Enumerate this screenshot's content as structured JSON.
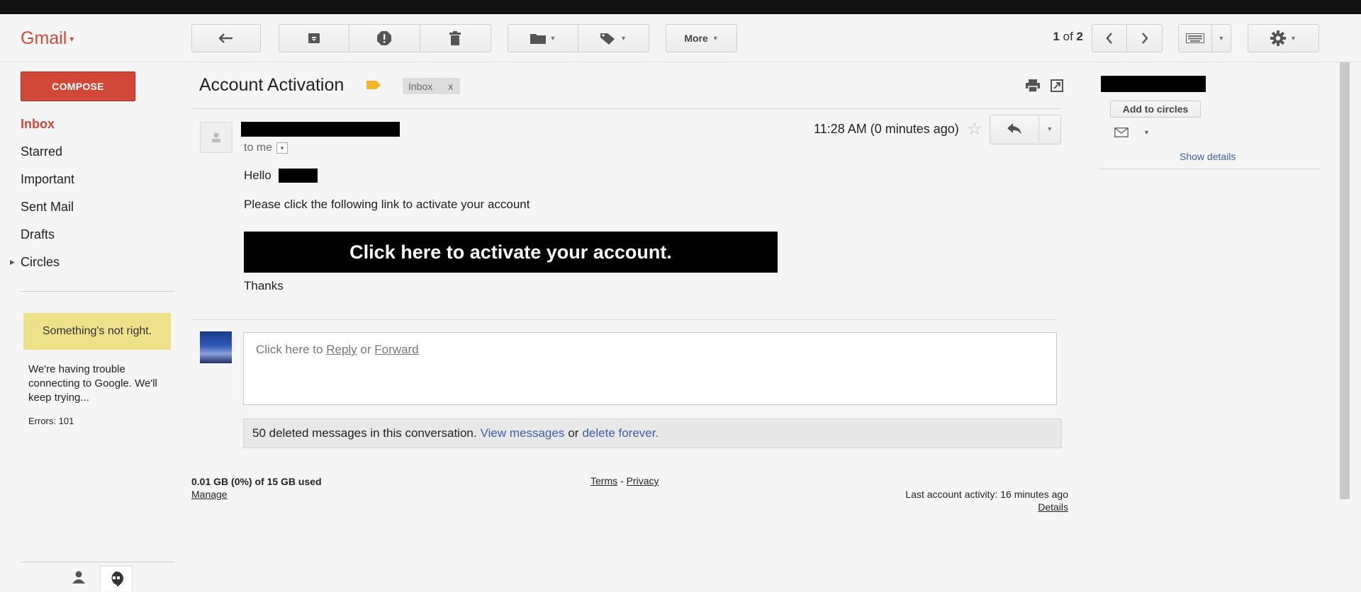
{
  "app": {
    "logo": "Gmail",
    "colors": {
      "brand_red": "#d14836",
      "link_blue": "#3b5ea7",
      "warning_yellow": "#ede18a"
    }
  },
  "toolbar": {
    "back_icon": "arrow-left-icon",
    "archive_icon": "archive-icon",
    "spam_icon": "report-spam-icon",
    "delete_icon": "trash-icon",
    "move_icon": "folder-icon",
    "labels_icon": "label-icon",
    "more_label": "More",
    "pager_current": "1",
    "pager_sep": "of",
    "pager_total": "2",
    "prev_icon": "chevron-left-icon",
    "next_icon": "chevron-right-icon",
    "keyboard_icon": "keyboard-icon",
    "settings_icon": "gear-icon"
  },
  "sidebar": {
    "compose_label": "COMPOSE",
    "items": [
      {
        "label": "Inbox",
        "active": true
      },
      {
        "label": "Starred"
      },
      {
        "label": "Important"
      },
      {
        "label": "Sent Mail"
      },
      {
        "label": "Drafts"
      },
      {
        "label": "Circles"
      }
    ],
    "warning_title": "Something's not right.",
    "warning_message": "We're having trouble connecting to Google. We'll keep trying...",
    "errors_text": "Errors: 101"
  },
  "message": {
    "subject": "Account Activation",
    "inbox_label": "Inbox",
    "inbox_label_close": "x",
    "to_text": "to me",
    "timestamp": "11:28 AM (0 minutes ago)",
    "greeting": "Hello",
    "body_line": "Please click the following link to activate your account",
    "cta_text": "Click here to activate your account.",
    "closing": "Thanks"
  },
  "reply": {
    "prefix": "Click here to",
    "reply_link": "Reply",
    "or_text": "or",
    "forward_link": "Forward"
  },
  "deleted": {
    "text": "50 deleted messages in this conversation.",
    "view_link": "View messages",
    "or_text": "or",
    "delete_link": "delete forever."
  },
  "footer": {
    "storage": "0.01 GB (0%) of 15 GB used",
    "manage_link": "Manage",
    "terms_link": "Terms",
    "dash": "-",
    "privacy_link": "Privacy",
    "activity": "Last account activity: 16 minutes ago",
    "details_link": "Details"
  },
  "right_panel": {
    "add_circles_label": "Add to circles",
    "show_details_link": "Show details"
  }
}
